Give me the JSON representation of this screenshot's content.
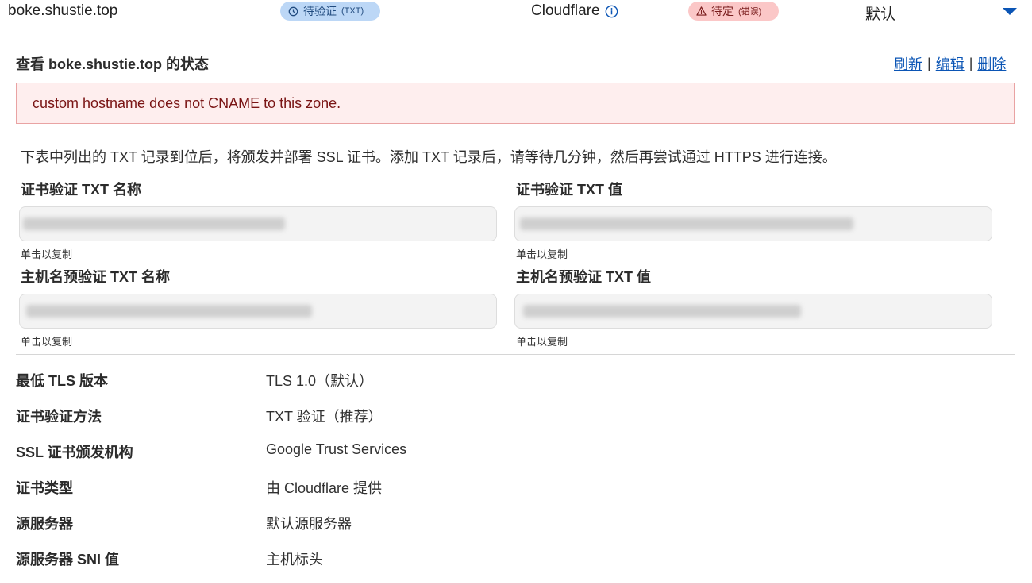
{
  "header": {
    "hostname": "boke.shustie.top",
    "status_pill": {
      "label": "待验证",
      "sub": "(TXT)",
      "icon": "clock-icon"
    },
    "provider": {
      "name": "Cloudflare",
      "icon": "info-icon"
    },
    "cert_pill": {
      "label": "待定",
      "sub": "(错误)",
      "icon": "warning-icon"
    },
    "default_label": "默认",
    "expand_icon": "chevron-down-icon"
  },
  "section": {
    "title": "查看 boke.shustie.top 的状态",
    "actions": {
      "refresh": "刷新",
      "edit": "编辑",
      "delete": "删除",
      "separator": "|"
    }
  },
  "error": {
    "message": "custom hostname does not CNAME to this zone."
  },
  "description": "下表中列出的 TXT 记录到位后，将颁发并部署 SSL 证书。添加 TXT 记录后，请等待几分钟，然后再尝试通过 HTTPS 进行连接。",
  "txt_fields": {
    "cert_name_label": "证书验证 TXT 名称",
    "cert_value_label": "证书验证 TXT 值",
    "host_name_label": "主机名预验证 TXT 名称",
    "host_value_label": "主机名预验证 TXT 值",
    "copy_hint": "单击以复制"
  },
  "details": [
    {
      "label": "最低 TLS 版本",
      "value": "TLS 1.0（默认）"
    },
    {
      "label": "证书验证方法",
      "value": "TXT 验证（推荐）"
    },
    {
      "label": "SSL 证书颁发机构",
      "value": "Google Trust Services"
    },
    {
      "label": "证书类型",
      "value": "由 Cloudflare 提供"
    },
    {
      "label": "源服务器",
      "value": "默认源服务器"
    },
    {
      "label": "源服务器 SNI 值",
      "value": "主机标头"
    }
  ],
  "colors": {
    "accent": "#0b55b5",
    "pending_pill": "#bcd7f6",
    "error_pill": "#fbc7c7",
    "error_bg": "#feeeee",
    "error_border": "#e9a3a3"
  }
}
